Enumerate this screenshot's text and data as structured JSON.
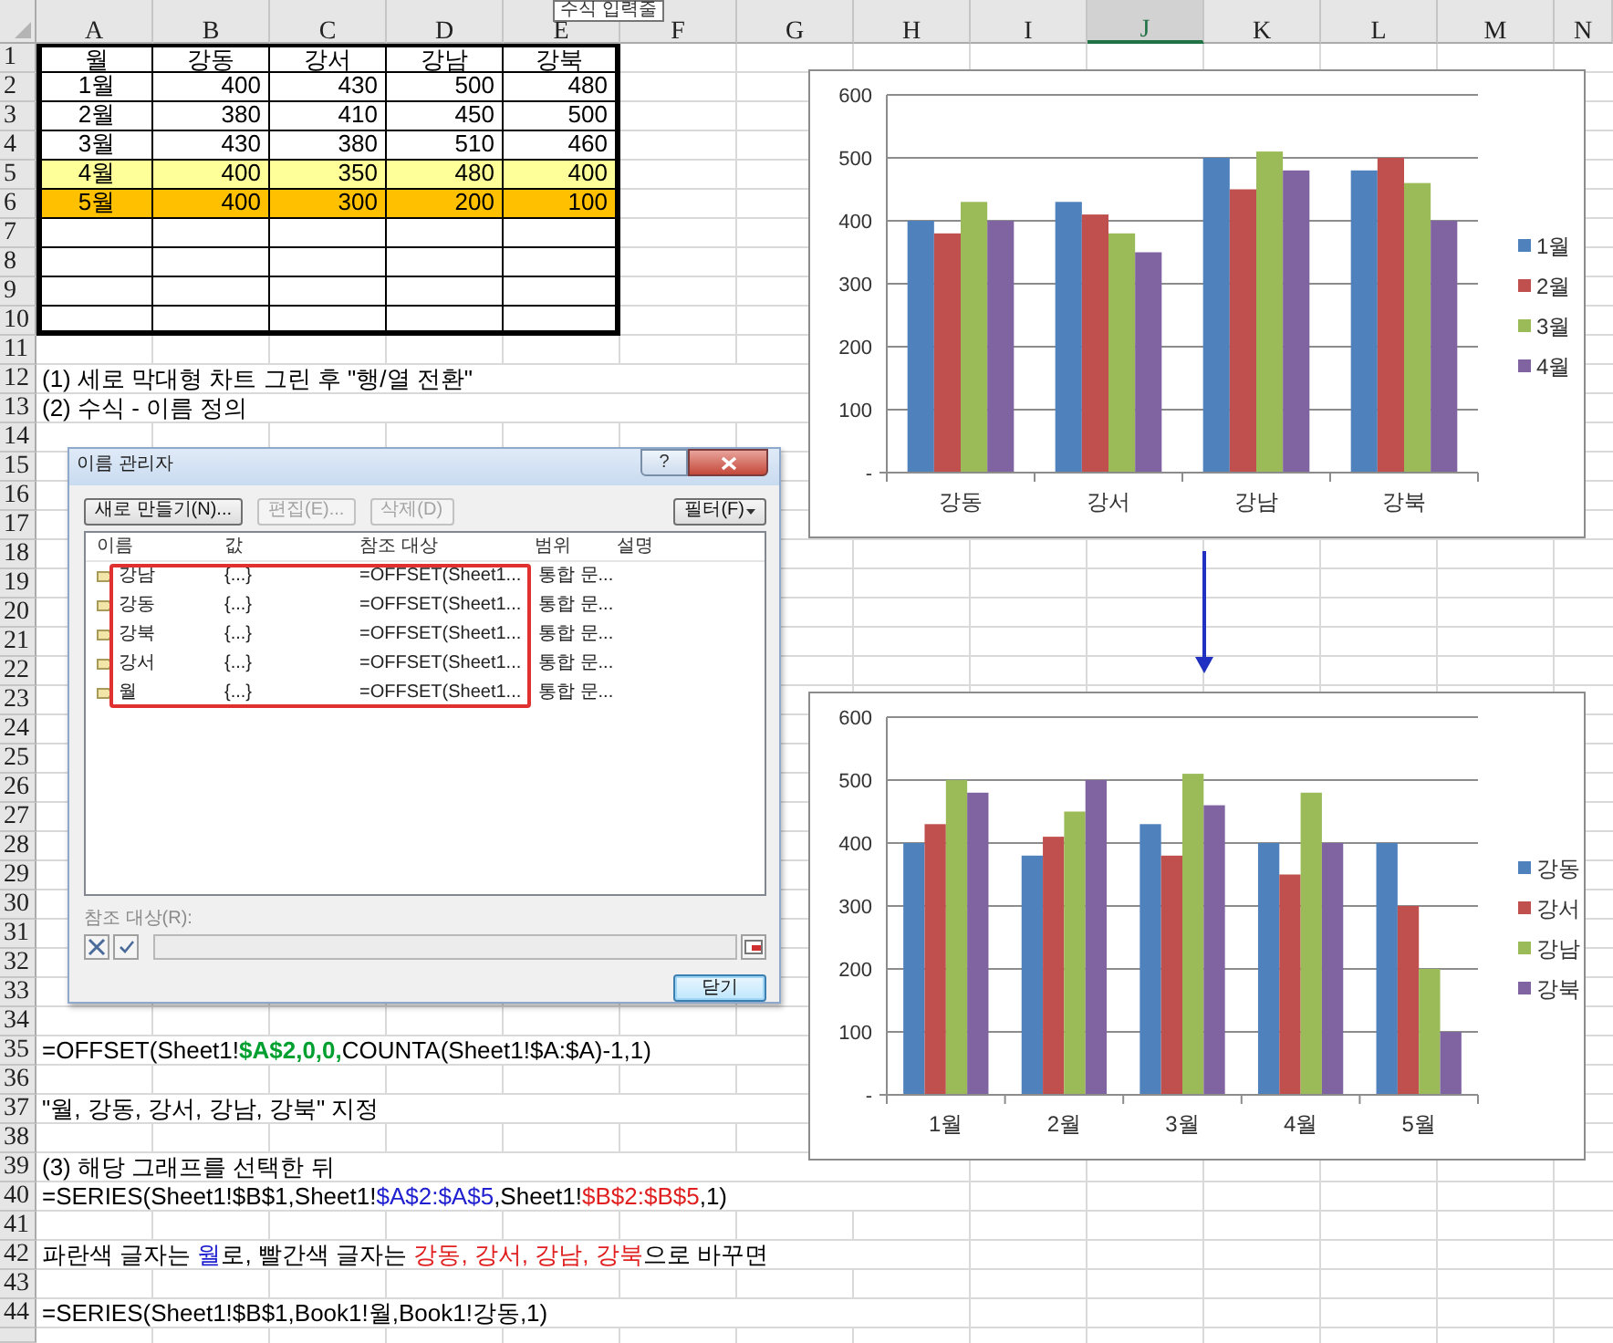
{
  "formula_tooltip": "수식 입력줄",
  "columns": [
    {
      "label": "A",
      "selected": false
    },
    {
      "label": "B",
      "selected": false
    },
    {
      "label": "C",
      "selected": false
    },
    {
      "label": "D",
      "selected": false
    },
    {
      "label": "E",
      "selected": false
    },
    {
      "label": "F",
      "selected": false
    },
    {
      "label": "G",
      "selected": false
    },
    {
      "label": "H",
      "selected": false
    },
    {
      "label": "I",
      "selected": false
    },
    {
      "label": "J",
      "selected": true
    },
    {
      "label": "K",
      "selected": false
    },
    {
      "label": "L",
      "selected": false
    },
    {
      "label": "M",
      "selected": false
    },
    {
      "label": "N",
      "selected": false
    }
  ],
  "rows": [
    {
      "number": "1",
      "kind": "table_header",
      "cells": [
        "월",
        "강동",
        "강서",
        "강남",
        "강북"
      ]
    },
    {
      "number": "2",
      "kind": "table",
      "cells": [
        "1월",
        "400",
        "430",
        "500",
        "480"
      ]
    },
    {
      "number": "3",
      "kind": "table",
      "cells": [
        "2월",
        "380",
        "410",
        "450",
        "500"
      ]
    },
    {
      "number": "4",
      "kind": "table",
      "cells": [
        "3월",
        "430",
        "380",
        "510",
        "460"
      ]
    },
    {
      "number": "5",
      "kind": "table",
      "color": "#ffff99",
      "cells": [
        "4월",
        "400",
        "350",
        "480",
        "400"
      ]
    },
    {
      "number": "6",
      "kind": "table",
      "color": "#ffc000",
      "cells": [
        "5월",
        "400",
        "300",
        "200",
        "100"
      ]
    },
    {
      "number": "7",
      "kind": "table"
    },
    {
      "number": "8",
      "kind": "table"
    },
    {
      "number": "9",
      "kind": "table"
    },
    {
      "number": "10",
      "kind": "table"
    },
    {
      "number": "11"
    },
    {
      "number": "12",
      "kind": "note",
      "segments": [
        {
          "text": "(1) 세로 막대형 차트 그린 후 \"행/열 전환\""
        }
      ]
    },
    {
      "number": "13",
      "kind": "note",
      "segments": [
        {
          "text": "(2) 수식 - 이름 정의"
        }
      ]
    },
    {
      "number": "14"
    },
    {
      "number": "15"
    },
    {
      "number": "16"
    },
    {
      "number": "17"
    },
    {
      "number": "18"
    },
    {
      "number": "19"
    },
    {
      "number": "20"
    },
    {
      "number": "21"
    },
    {
      "number": "22"
    },
    {
      "number": "23"
    },
    {
      "number": "24"
    },
    {
      "number": "25"
    },
    {
      "number": "26"
    },
    {
      "number": "27"
    },
    {
      "number": "28"
    },
    {
      "number": "29"
    },
    {
      "number": "30"
    },
    {
      "number": "31"
    },
    {
      "number": "32"
    },
    {
      "number": "33"
    },
    {
      "number": "34"
    },
    {
      "number": "35",
      "kind": "note",
      "segments": [
        {
          "text": "=OFFSET(Sheet1!"
        },
        {
          "text": "$A$2,0,0,",
          "color": "#00a030",
          "bold": true
        },
        {
          "text": "COUNTA(Sheet1!$A:$A)-1,1)"
        }
      ]
    },
    {
      "number": "36"
    },
    {
      "number": "37",
      "kind": "note",
      "segments": [
        {
          "text": "\"월, 강동, 강서, 강남, 강북\" 지정"
        }
      ]
    },
    {
      "number": "38"
    },
    {
      "number": "39",
      "kind": "note",
      "segments": [
        {
          "text": "(3) 해당 그래프를 선택한 뒤"
        }
      ]
    },
    {
      "number": "40",
      "kind": "note",
      "segments": [
        {
          "text": "=SERIES(Sheet1!$B$1,Sheet1!"
        },
        {
          "text": "$A$2:$A$5",
          "color": "#2020d0"
        },
        {
          "text": ",Sheet1!"
        },
        {
          "text": "$B$2:$B$5",
          "color": "#e02020"
        },
        {
          "text": ",1)"
        }
      ]
    },
    {
      "number": "41"
    },
    {
      "number": "42",
      "kind": "note",
      "segments": [
        {
          "text": "파란색 글자는 "
        },
        {
          "text": "월",
          "color": "#2020d0"
        },
        {
          "text": "로, 빨간색 글자는 "
        },
        {
          "text": "강동, 강서, 강남, 강북",
          "color": "#e02020"
        },
        {
          "text": "으로 바꾸면"
        }
      ]
    },
    {
      "number": "43"
    },
    {
      "number": "44",
      "kind": "note",
      "segments": [
        {
          "text": "=SERIES(Sheet1!$B$1,Book1!월,Book1!강동,1)"
        }
      ]
    }
  ],
  "charts": [
    {
      "chart_data": {
        "type": "bar",
        "grid": true,
        "legend": true,
        "categories": [
          "강동",
          "강서",
          "강남",
          "강북"
        ],
        "ylim": [
          0,
          600
        ],
        "yticks": [
          {
            "value": 0,
            "label": "-"
          },
          {
            "value": 100,
            "label": "100"
          },
          {
            "value": 200,
            "label": "200"
          },
          {
            "value": 300,
            "label": "300"
          },
          {
            "value": 400,
            "label": "400"
          },
          {
            "value": 500,
            "label": "500"
          },
          {
            "value": 600,
            "label": "600"
          }
        ],
        "series": [
          {
            "name": "1월",
            "color": "#4f81bd",
            "values": [
              400,
              430,
              500,
              480
            ]
          },
          {
            "name": "2월",
            "color": "#c0504d",
            "values": [
              380,
              410,
              450,
              500
            ]
          },
          {
            "name": "3월",
            "color": "#9bbb59",
            "values": [
              430,
              380,
              510,
              460
            ]
          },
          {
            "name": "4월",
            "color": "#8064a2",
            "values": [
              400,
              350,
              480,
              400
            ]
          }
        ]
      }
    },
    {
      "chart_data": {
        "type": "bar",
        "grid": true,
        "legend": true,
        "categories": [
          "1월",
          "2월",
          "3월",
          "4월",
          "5월"
        ],
        "ylim": [
          0,
          600
        ],
        "yticks": [
          {
            "value": 0,
            "label": "-"
          },
          {
            "value": 100,
            "label": "100"
          },
          {
            "value": 200,
            "label": "200"
          },
          {
            "value": 300,
            "label": "300"
          },
          {
            "value": 400,
            "label": "400"
          },
          {
            "value": 500,
            "label": "500"
          },
          {
            "value": 600,
            "label": "600"
          }
        ],
        "series": [
          {
            "name": "강동",
            "color": "#4f81bd",
            "values": [
              400,
              380,
              430,
              400,
              400
            ]
          },
          {
            "name": "강서",
            "color": "#c0504d",
            "values": [
              430,
              410,
              380,
              350,
              300
            ]
          },
          {
            "name": "강남",
            "color": "#9bbb59",
            "values": [
              500,
              450,
              510,
              480,
              200
            ]
          },
          {
            "name": "강북",
            "color": "#8064a2",
            "values": [
              480,
              500,
              460,
              400,
              100
            ]
          }
        ]
      }
    }
  ],
  "name_manager": {
    "title": "이름 관리자",
    "help": "?",
    "toolbar": [
      {
        "label": "새로 만들기(N)...",
        "disabled": false
      },
      {
        "label": "편집(E)...",
        "disabled": true
      },
      {
        "label": "삭제(D)",
        "disabled": true
      }
    ],
    "filter": "필터(F)",
    "columns": [
      "이름",
      "값",
      "참조 대상",
      "범위",
      "설명"
    ],
    "highlight": true,
    "names": [
      {
        "name": "강남",
        "value": "{...}",
        "refers_to": "=OFFSET(Sheet1...",
        "scope": "통합 문..."
      },
      {
        "name": "강동",
        "value": "{...}",
        "refers_to": "=OFFSET(Sheet1...",
        "scope": "통합 문..."
      },
      {
        "name": "강북",
        "value": "{...}",
        "refers_to": "=OFFSET(Sheet1...",
        "scope": "통합 문..."
      },
      {
        "name": "강서",
        "value": "{...}",
        "refers_to": "=OFFSET(Sheet1...",
        "scope": "통합 문..."
      },
      {
        "name": "월",
        "value": "{...}",
        "refers_to": "=OFFSET(Sheet1...",
        "scope": "통합 문..."
      }
    ],
    "refers_label": "참조 대상(R):",
    "close": "닫기"
  }
}
